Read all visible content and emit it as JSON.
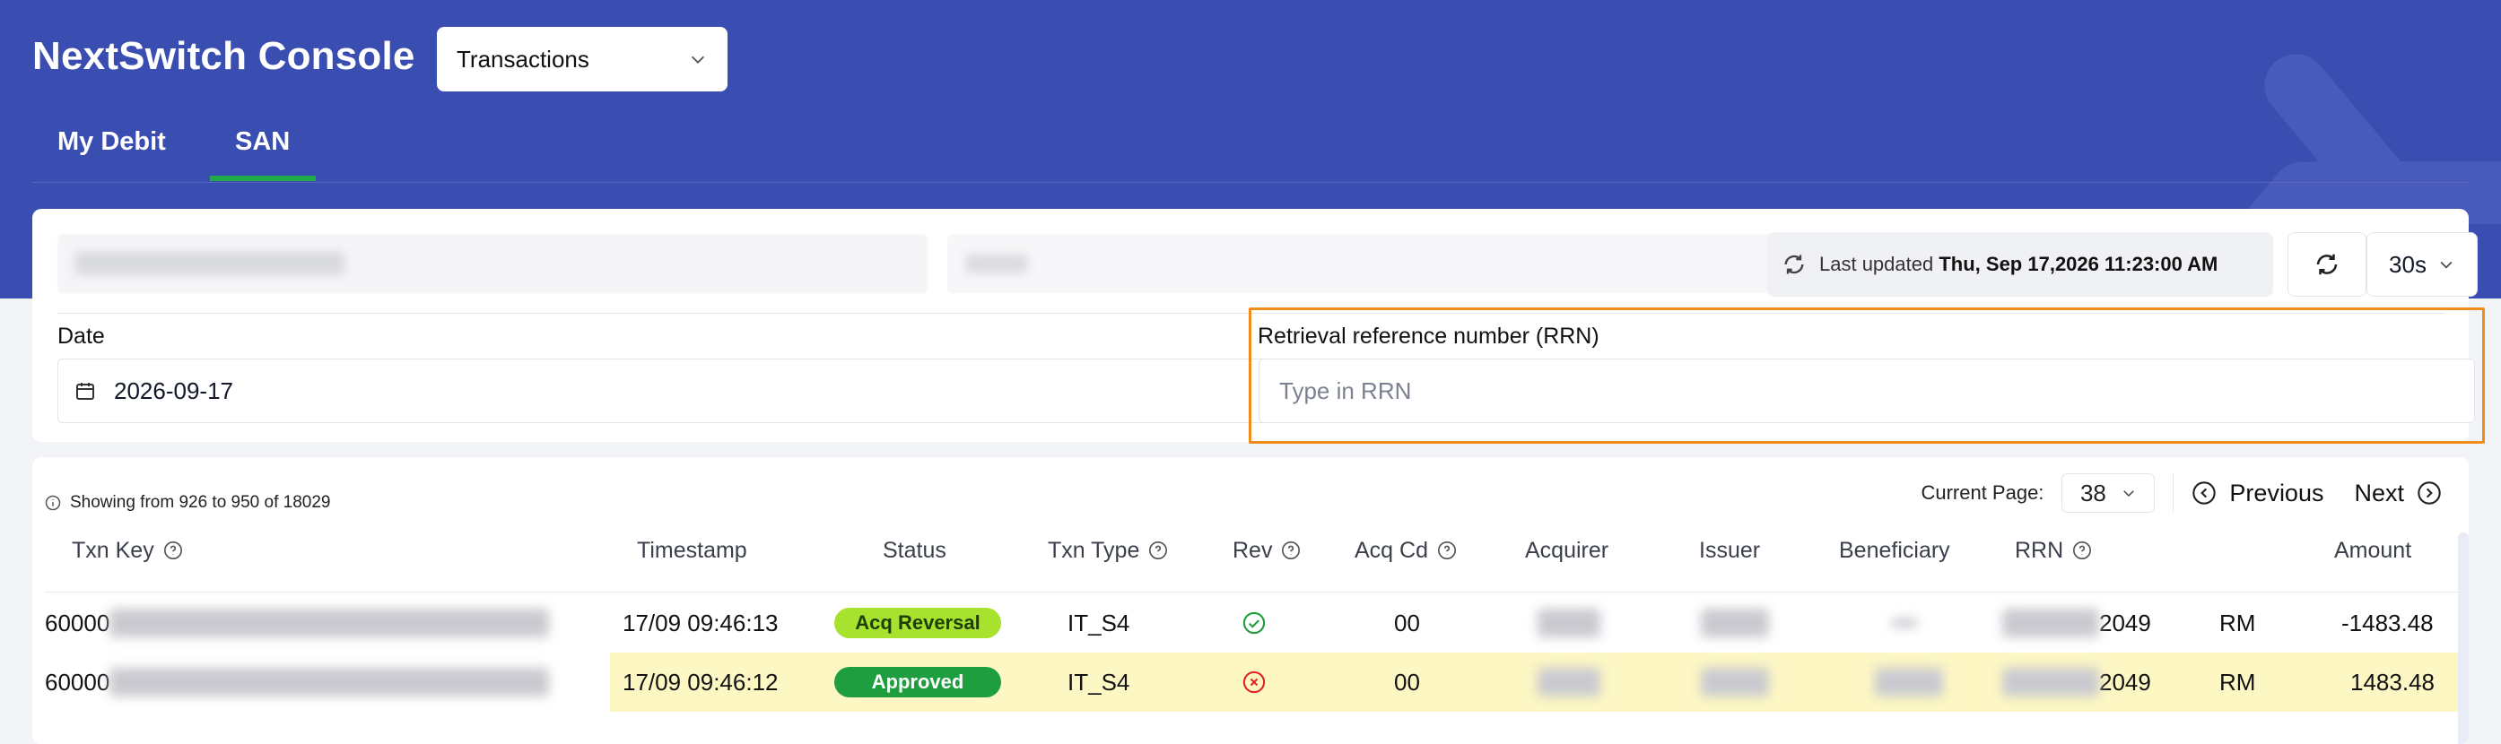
{
  "app": {
    "title": "NextSwitch Console"
  },
  "module_select": {
    "value": "Transactions"
  },
  "tabs": [
    {
      "label": "My Debit",
      "active": false
    },
    {
      "label": "SAN",
      "active": true
    }
  ],
  "toolbar": {
    "last_updated_label": "Last updated",
    "last_updated_value": "Thu, Sep 17,2026 11:23:00 AM",
    "interval": "30s"
  },
  "filters": {
    "date_label": "Date",
    "date_value": "2026-09-17",
    "rrn_label": "Retrieval reference number (RRN)",
    "rrn_placeholder": "Type in RRN"
  },
  "table": {
    "showing_text": "Showing from 926 to 950 of 18029",
    "current_page_label": "Current Page:",
    "current_page": "38",
    "previous_label": "Previous",
    "next_label": "Next",
    "columns": [
      "Txn Key",
      "Timestamp",
      "Status",
      "Txn Type",
      "Rev",
      "Acq Cd",
      "Acquirer",
      "Issuer",
      "Beneficiary",
      "RRN",
      "Amount"
    ],
    "rows": [
      {
        "txn_key_prefix": "60000",
        "timestamp": "17/09 09:46:13",
        "status": "Acq Reversal",
        "txn_type": "IT_S4",
        "rev": "ok",
        "acq_cd": "00",
        "rrn_suffix": "2049",
        "currency": "RM",
        "amount": "-1483.48"
      },
      {
        "txn_key_prefix": "60000",
        "timestamp": "17/09 09:46:12",
        "status": "Approved",
        "txn_type": "IT_S4",
        "rev": "fail",
        "acq_cd": "00",
        "rrn_suffix": "2049",
        "currency": "RM",
        "amount": "1483.48"
      }
    ]
  },
  "colors": {
    "header": "#3a4db0",
    "tab_underline": "#22a94a",
    "highlight_border": "#f08c1a",
    "status_acq_reversal": "#a6e22e",
    "status_approved": "#1e9e3e",
    "row_highlight": "#fdf7c4"
  }
}
